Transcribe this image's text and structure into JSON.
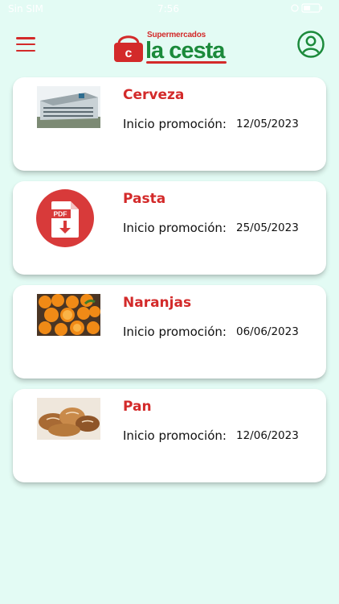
{
  "status_bar": {
    "carrier": "Sin SIM",
    "time": "7:56",
    "battery_level": 0.45
  },
  "header": {
    "logo_small": "Supermercados",
    "logo_big": "la cesta",
    "menu_icon": "hamburger-menu-icon",
    "profile_icon": "user-circle-icon",
    "brand_red": "#d32a2a",
    "brand_green": "#1b8a3b"
  },
  "promotions": [
    {
      "title": "Cerveza",
      "label": "Inicio promoción:",
      "date": "12/05/2023",
      "thumb": "building-photo"
    },
    {
      "title": "Pasta",
      "label": "Inicio promoción:",
      "date": "25/05/2023",
      "thumb": "pdf-icon"
    },
    {
      "title": "Naranjas",
      "label": "Inicio promoción:",
      "date": "06/06/2023",
      "thumb": "oranges-photo"
    },
    {
      "title": "Pan",
      "label": "Inicio promoción:",
      "date": "12/06/2023",
      "thumb": "bread-photo"
    }
  ]
}
